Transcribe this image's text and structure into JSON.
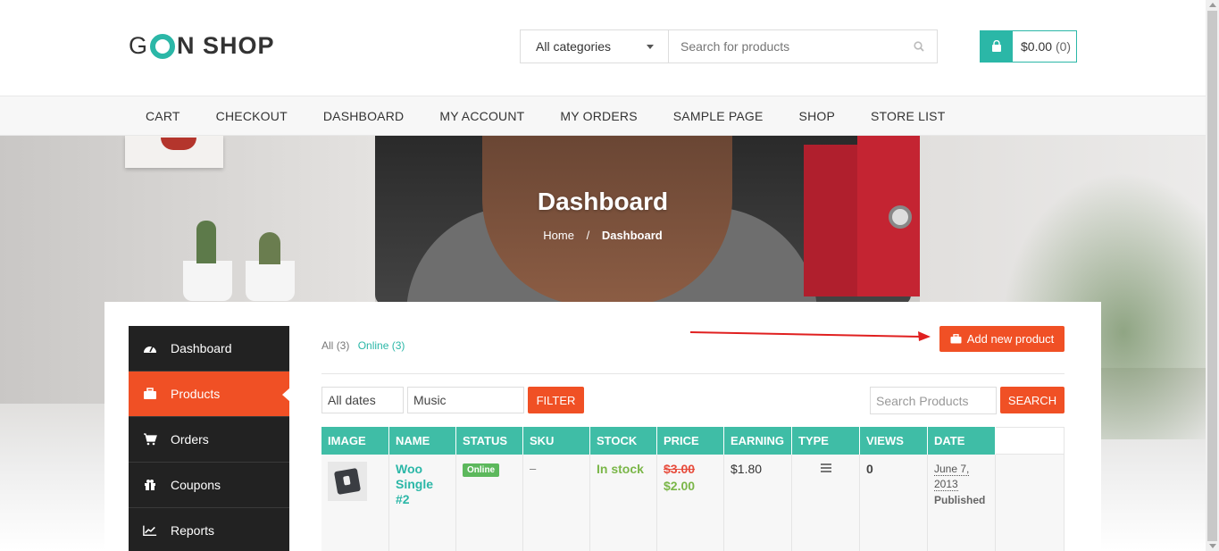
{
  "brand": {
    "logo_left": "G",
    "logo_right": "N SHOP"
  },
  "search": {
    "category": "All categories",
    "placeholder": "Search for products"
  },
  "cart": {
    "amount": "$0.00",
    "count": "(0)"
  },
  "nav": [
    "CART",
    "CHECKOUT",
    "DASHBOARD",
    "MY ACCOUNT",
    "MY ORDERS",
    "SAMPLE PAGE",
    "SHOP",
    "STORE LIST"
  ],
  "hero": {
    "title": "Dashboard",
    "breadcrumb_home": "Home",
    "breadcrumb_sep": "/",
    "breadcrumb_current": "Dashboard"
  },
  "sidebar": [
    {
      "label": "Dashboard",
      "icon": "dashboard-icon"
    },
    {
      "label": "Products",
      "icon": "briefcase-icon"
    },
    {
      "label": "Orders",
      "icon": "cart-icon"
    },
    {
      "label": "Coupons",
      "icon": "gift-icon"
    },
    {
      "label": "Reports",
      "icon": "chart-icon"
    }
  ],
  "products": {
    "filter_all": "All",
    "filter_all_count": "(3)",
    "filter_online": "Online (3)",
    "add_button": "Add new product",
    "date_filter": "All dates",
    "category_filter": "Music",
    "filter_button": "FILTER",
    "search_placeholder": "Search Products",
    "search_button": "SEARCH",
    "columns": [
      "IMAGE",
      "NAME",
      "STATUS",
      "SKU",
      "STOCK",
      "PRICE",
      "EARNING",
      "TYPE",
      "VIEWS",
      "DATE"
    ],
    "rows": [
      {
        "name": "Woo Single #2",
        "status": "Online",
        "sku": "–",
        "stock": "In stock",
        "price_old": "$3.00",
        "price_new": "$2.00",
        "earning": "$1.80",
        "views": "0",
        "date": "June 7, 2013",
        "date_status": "Published"
      }
    ]
  },
  "colors": {
    "accent": "#2bb7a7",
    "orange": "#f05025",
    "sidebar_bg": "#222222",
    "table_header": "#3fbda6"
  }
}
